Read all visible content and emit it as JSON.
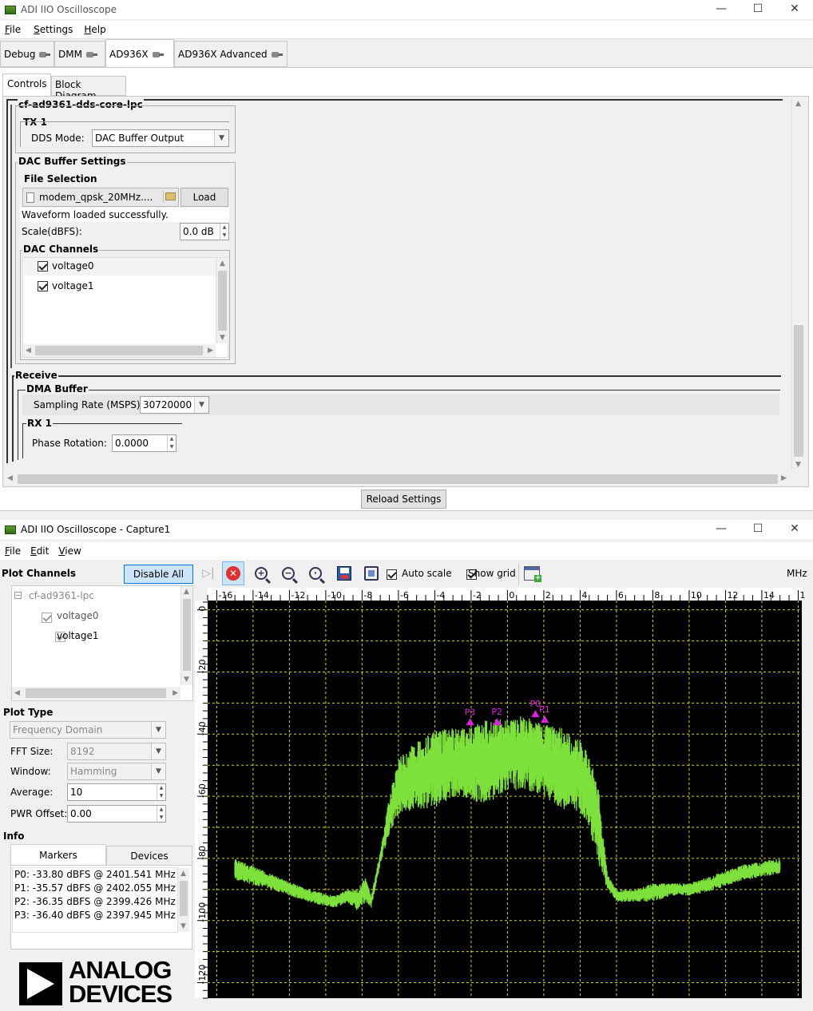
{
  "win1": {
    "title": "ADI IIO Oscilloscope",
    "controls": [
      "—",
      "☐",
      "✕"
    ],
    "menu": [
      {
        "pre": "",
        "u": "F",
        "post": "ile"
      },
      {
        "pre": "",
        "u": "S",
        "post": "ettings"
      },
      {
        "pre": "",
        "u": "H",
        "post": "elp"
      }
    ],
    "tabs": [
      "Debug",
      "DMM",
      "AD936X",
      "AD936X Advanced"
    ],
    "subtabs": [
      "Controls",
      "Block Diagram"
    ],
    "tx_device": "cf-ad9361-dds-core-lpc",
    "tx1": {
      "title": "TX 1",
      "dds_mode_label": "DDS Mode:",
      "dds_mode_value": "DAC Buffer Output"
    },
    "dac_buffer": {
      "title": "DAC Buffer Settings",
      "file_selection_label": "File Selection",
      "file_name": "modem_qpsk_20MHz....",
      "load_label": "Load",
      "status": "Waveform loaded successfully.",
      "scale_label": "Scale(dBFS):",
      "scale_value": "0.0 dB",
      "channels_title": "DAC Channels",
      "channels": [
        "voltage0",
        "voltage1"
      ]
    },
    "receive": {
      "title": "Receive",
      "dma_title": "DMA Buffer",
      "sampling_label": "Sampling Rate (MSPS)",
      "sampling_value": "30720000",
      "rx1_title": "RX 1",
      "phase_label": "Phase Rotation:",
      "phase_value": "0.0000"
    },
    "reload_label": "Reload Settings"
  },
  "win2": {
    "title": "ADI IIO Oscilloscope - Capture1",
    "controls": [
      "—",
      "☐",
      "✕"
    ],
    "menu": [
      {
        "pre": "",
        "u": "F",
        "post": "ile"
      },
      {
        "pre": "",
        "u": "E",
        "post": "dit"
      },
      {
        "pre": "",
        "u": "V",
        "post": "iew"
      }
    ],
    "plot_channels_label": "Plot Channels",
    "disable_all_label": "Disable All",
    "tree_device": "cf-ad9361-lpc",
    "tree_channels": [
      "voltage0",
      "voltage1"
    ],
    "plot_type_label": "Plot Type",
    "plot_type_value": "Frequency Domain",
    "fft_size_label": "FFT Size:",
    "fft_size_value": "8192",
    "window_label": "Window:",
    "window_value": "Hamming",
    "average_label": "Average:",
    "average_value": "10",
    "pwr_offset_label": "PWR Offset:",
    "pwr_offset_value": "0.00",
    "info_label": "Info",
    "info_tabs": [
      "Markers",
      "Devices"
    ],
    "markers": [
      "P0: -33.80 dBFS @ 2401.541 MHz",
      "P1: -35.57 dBFS @ 2402.055 MHz",
      "P2: -36.35 dBFS @ 2399.426 MHz",
      "P3: -36.40 dBFS @ 2397.945 MHz"
    ],
    "toolbar": {
      "auto_scale_label": "Auto scale",
      "show_grid_label": "Show grid",
      "units": "MHz"
    },
    "logo": {
      "line1": "ANALOG",
      "line2": "DEVICES"
    }
  },
  "chart_data": {
    "type": "line",
    "xlabel": "MHz",
    "ylabel": "",
    "xlim": [
      -16.5,
      16.2
    ],
    "ylim": [
      -125,
      3
    ],
    "x_ticks": [
      "-16",
      "-14",
      "-12",
      "-10",
      "-8",
      "-6",
      "-4",
      "-2",
      "0",
      "2",
      "4",
      "6",
      "8",
      "10",
      "12",
      "14",
      "1"
    ],
    "y_ticks": [
      "0",
      "-20",
      "-40",
      "-60",
      "-80",
      "-100",
      "-120"
    ],
    "grid": true,
    "trace_color": "#7ee03a",
    "background": "#000000",
    "series": [
      {
        "x": [
          -15,
          -13,
          -11,
          -9.5,
          -8.8,
          -8.3,
          -7.8,
          -7.5,
          -7,
          -6.5,
          -6,
          -5,
          -4,
          -3,
          -2,
          -1,
          0,
          1,
          2,
          3,
          4,
          4.5,
          5,
          5.5,
          6,
          7,
          8,
          9,
          10,
          11,
          12,
          13,
          14,
          15
        ],
        "y_top": [
          -80,
          -85,
          -90,
          -92,
          -90,
          -90,
          -86,
          -92,
          -78,
          -60,
          -48,
          -42,
          -39,
          -38,
          -37,
          -35,
          -35,
          -34,
          -37,
          -38,
          -42,
          -47,
          -57,
          -85,
          -90,
          -90,
          -88,
          -88,
          -88,
          -86,
          -84,
          -82,
          -81,
          -80
        ],
        "y_bottom": [
          -87,
          -90,
          -94,
          -96,
          -94,
          -97,
          -94,
          -96,
          -82,
          -72,
          -66,
          -64,
          -64,
          -60,
          -62,
          -62,
          -58,
          -58,
          -60,
          -64,
          -65,
          -70,
          -82,
          -90,
          -94,
          -94,
          -94,
          -92,
          -92,
          -91,
          -89,
          -87,
          -86,
          -85
        ]
      }
    ],
    "markers": [
      {
        "name": "P0",
        "x": 1.541,
        "y": -33.8
      },
      {
        "name": "P1",
        "x": 2.055,
        "y": -35.57
      },
      {
        "name": "P2",
        "x": -0.574,
        "y": -36.35
      },
      {
        "name": "P3",
        "x": -2.055,
        "y": -36.4
      }
    ]
  }
}
